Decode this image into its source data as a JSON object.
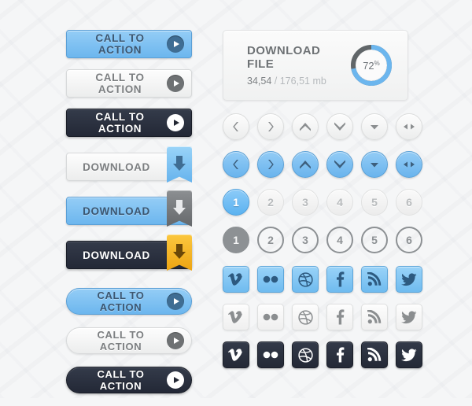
{
  "theme": {
    "page_bg": "#f5f6f7",
    "accent_blue": "#6cb6ee",
    "accent_dark": "#262b38",
    "accent_gray": "#8d9194",
    "accent_gold": "#eda412",
    "progress_track": "#616669"
  },
  "left_column": {
    "cta_blue": {
      "label": "CALL TO ACTION",
      "icon": "play-icon"
    },
    "cta_light": {
      "label": "CALL TO ACTION",
      "icon": "play-icon"
    },
    "cta_dark": {
      "label": "CALL TO ACTION",
      "icon": "play-icon"
    },
    "download_light": {
      "label": "DOWNLOAD",
      "icon": "download-arrow-icon"
    },
    "download_blue": {
      "label": "DOWNLOAD",
      "icon": "download-arrow-icon"
    },
    "download_dark": {
      "label": "DOWNLOAD",
      "icon": "download-arrow-icon"
    },
    "pill_blue": {
      "label": "CALL TO ACTION",
      "icon": "play-icon"
    },
    "pill_light": {
      "label": "CALL TO ACTION",
      "icon": "play-icon"
    },
    "pill_dark": {
      "label": "CALL TO ACTION",
      "icon": "play-icon"
    }
  },
  "download_panel": {
    "title": "DOWNLOAD FILE",
    "downloaded": "34,54",
    "separator": "/",
    "total": "176,51 mb",
    "progress_percent": 72,
    "progress_label": "72",
    "progress_unit": "%"
  },
  "nav_icons": [
    {
      "name": "chevron-left-icon",
      "glyph": "chevron-left"
    },
    {
      "name": "chevron-right-icon",
      "glyph": "chevron-right"
    },
    {
      "name": "chevron-up-icon",
      "glyph": "chevron-up"
    },
    {
      "name": "chevron-down-icon",
      "glyph": "chevron-down"
    },
    {
      "name": "caret-down-icon",
      "glyph": "caret-down"
    },
    {
      "name": "arrows-left-right-icon",
      "glyph": "arrows-lr"
    }
  ],
  "pagination": {
    "pages": [
      "1",
      "2",
      "3",
      "4",
      "5",
      "6"
    ],
    "active": "1"
  },
  "social_icons": [
    {
      "name": "vimeo-icon",
      "label": "Vimeo"
    },
    {
      "name": "flickr-icon",
      "label": "Flickr"
    },
    {
      "name": "dribbble-icon",
      "label": "Dribbble"
    },
    {
      "name": "facebook-icon",
      "label": "Facebook"
    },
    {
      "name": "rss-icon",
      "label": "RSS"
    },
    {
      "name": "twitter-icon",
      "label": "Twitter"
    }
  ]
}
